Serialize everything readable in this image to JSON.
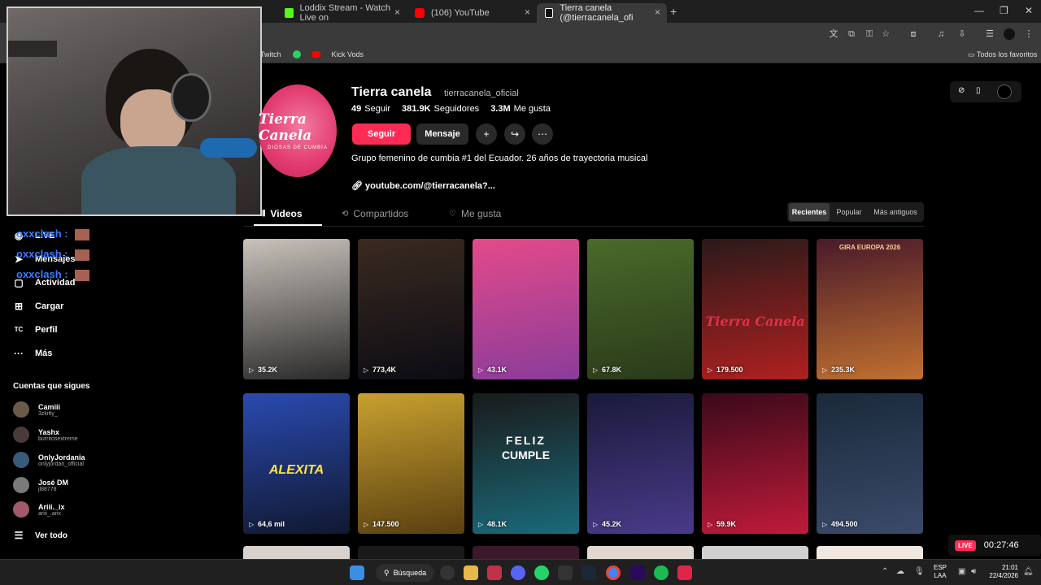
{
  "browser": {
    "tabs": [
      {
        "label": "Loddix Stream - Watch Live on",
        "color": "#53fc18"
      },
      {
        "label": "(106) YouTube",
        "color": "#ff0000"
      },
      {
        "label": "Tierra canela (@tierracanela_ofi",
        "color": "#ffffff"
      }
    ],
    "bookmarks": [
      "Twitch",
      "Kick Vods"
    ],
    "all_bookmarks": "Todos los favoritos"
  },
  "chat": {
    "user": "oxxclash",
    "lines": [
      "oxxclash :",
      "oxxclash :",
      "oxxclash :"
    ]
  },
  "sidebar": {
    "nav": [
      {
        "label": "LIVE",
        "icon": "live-icon"
      },
      {
        "label": "Mensajes",
        "icon": "send-icon"
      },
      {
        "label": "Actividad",
        "icon": "activity-icon"
      },
      {
        "label": "Cargar",
        "icon": "upload-icon"
      },
      {
        "label": "Perfil",
        "icon": "profile-icon"
      },
      {
        "label": "Más",
        "icon": "more-icon"
      }
    ],
    "following_title": "Cuentas que sigues",
    "following": [
      {
        "name": "Camiii",
        "handle": "3zkitty_",
        "color": "#6b5a4a"
      },
      {
        "name": "Yashx",
        "handle": "burritosextreme",
        "color": "#4a3a3a"
      },
      {
        "name": "OnlyJordania",
        "handle": "onlyjordan_official",
        "color": "#3a5a7a"
      },
      {
        "name": "José DM",
        "handle": "jl88778",
        "color": "#7a7a7a"
      },
      {
        "name": "Ariii._ix",
        "handle": "ariii_.arix",
        "color": "#a05a6a"
      }
    ],
    "see_all": "Ver todo"
  },
  "profile": {
    "name": "Tierra canela",
    "handle": "tierracanela_oficial",
    "logo_text": "Tierra Canela",
    "logo_sub": "DIOSAS DE CUMBIA",
    "following_count": "49",
    "following_label": "Seguir",
    "followers_count": "381.9K",
    "followers_label": "Seguidores",
    "likes_count": "3.3M",
    "likes_label": "Me gusta",
    "follow_button": "Seguir",
    "message_button": "Mensaje",
    "bio": "Grupo femenino de cumbia #1 del Ecuador. 26 años de trayectoria musical",
    "link": "youtube.com/@tierracanela?...",
    "tabs": [
      "Videos",
      "Compartidos",
      "Me gusta"
    ],
    "sort": [
      "Recientes",
      "Popular",
      "Más antiguos"
    ]
  },
  "videos": [
    {
      "views": "35.2K",
      "colors": [
        "#c9c2bb",
        "#2a2a2a"
      ]
    },
    {
      "views": "773,4K",
      "colors": [
        "#3a2a20",
        "#0c0c14"
      ]
    },
    {
      "views": "43.1K",
      "colors": [
        "#e44a8a",
        "#8a3c9a"
      ]
    },
    {
      "views": "67.8K",
      "colors": [
        "#4a6a2a",
        "#2a3a1a"
      ]
    },
    {
      "views": "179.500",
      "colors": [
        "#2a1a1a",
        "#b02020"
      ]
    },
    {
      "views": "235.3K",
      "colors": [
        "#4a1a2a",
        "#c07030"
      ]
    },
    {
      "views": "64,6 mil",
      "colors": [
        "#2a4ab0",
        "#101830"
      ]
    },
    {
      "views": "147.500",
      "colors": [
        "#c8a030",
        "#5a4010"
      ]
    },
    {
      "views": "48.1K",
      "colors": [
        "#1a1a1a",
        "#1a6a7a"
      ]
    },
    {
      "views": "45.2K",
      "colors": [
        "#1a1a3a",
        "#4a3a8a"
      ]
    },
    {
      "views": "59.9K",
      "colors": [
        "#3a0a1a",
        "#c01a3a"
      ]
    },
    {
      "views": "494.500",
      "colors": [
        "#1a2a3a",
        "#3a4a6a"
      ]
    }
  ],
  "overlay_texts": [
    "FELIZ",
    "CUMPLE",
    "ALEXITA",
    "Tierra Canela",
    "GIRA EUROPA 2026"
  ],
  "taskbar": {
    "search": "Búsqueda",
    "lang": "ESP",
    "lang2": "LAA",
    "time": "21:01",
    "date": "22/4/2026"
  },
  "live": {
    "badge": "LIVE",
    "timer": "00:27:46"
  }
}
